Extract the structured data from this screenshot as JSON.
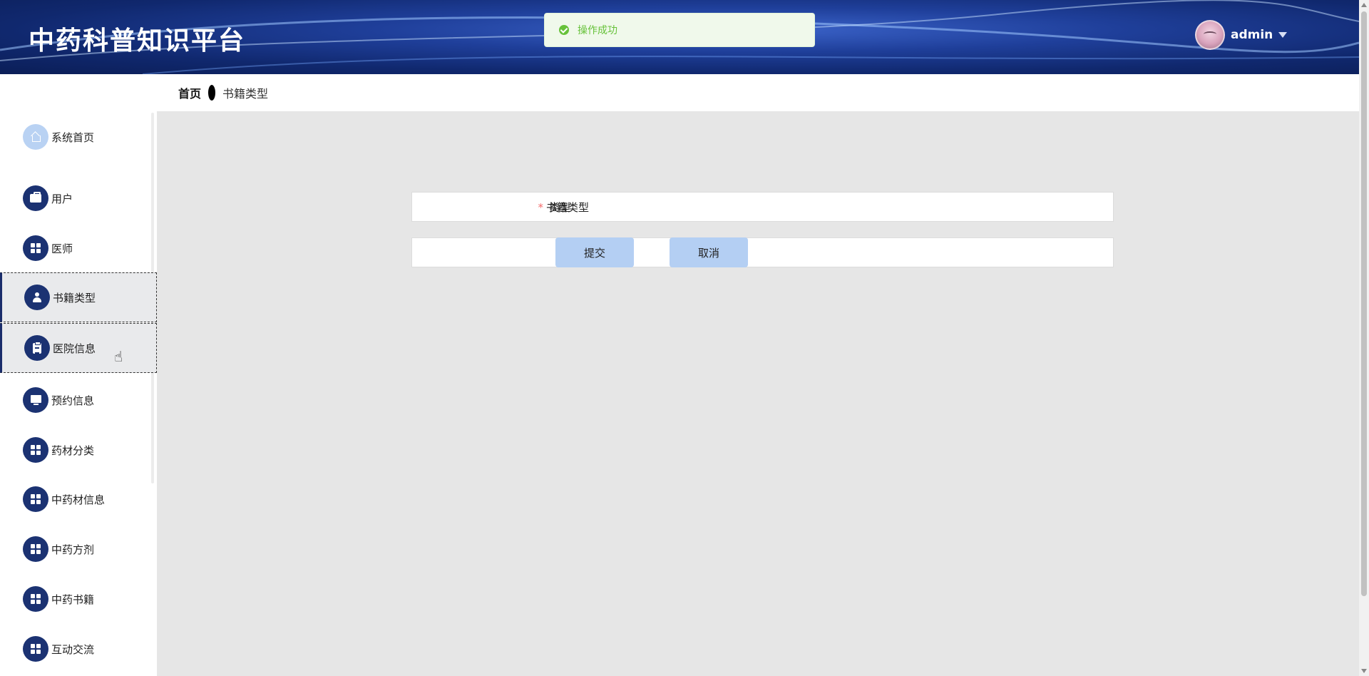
{
  "header": {
    "title": "中药科普知识平台",
    "user_name": "admin"
  },
  "toast": {
    "message": "操作成功",
    "color": "#67c23a"
  },
  "breadcrumb": {
    "home": "首页",
    "current": "书籍类型"
  },
  "sidebar": {
    "items": [
      {
        "label": "系统首页",
        "icon": "home-icon"
      },
      {
        "label": "用户",
        "icon": "briefcase-icon"
      },
      {
        "label": "医师",
        "icon": "grid-icon"
      },
      {
        "label": "书籍类型",
        "icon": "user-icon"
      },
      {
        "label": "医院信息",
        "icon": "clipboard-icon"
      },
      {
        "label": "预约信息",
        "icon": "monitor-icon"
      },
      {
        "label": "药材分类",
        "icon": "grid-icon"
      },
      {
        "label": "中药材信息",
        "icon": "grid-icon"
      },
      {
        "label": "中药方剂",
        "icon": "grid-icon"
      },
      {
        "label": "中药书籍",
        "icon": "grid-icon"
      },
      {
        "label": "互动交流",
        "icon": "grid-icon"
      }
    ]
  },
  "form": {
    "required_mark": "*",
    "type_label": "书籍类型",
    "type_value": "类型",
    "submit_label": "提交",
    "cancel_label": "取消"
  },
  "colors": {
    "header_bg": "#10286e",
    "menu_icon_bg": "#1b3272",
    "button_bg": "#b4cff3",
    "content_bg": "#e6e6e6"
  }
}
